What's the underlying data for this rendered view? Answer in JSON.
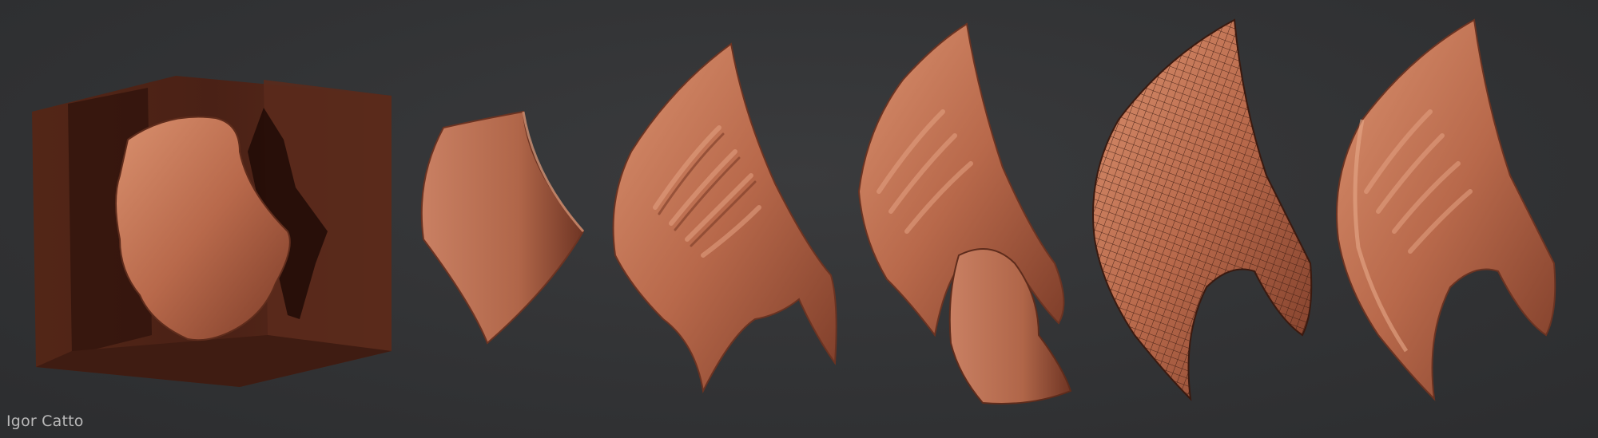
{
  "credit": {
    "author": "Igor Catto"
  },
  "stages": [
    {
      "name": "blockout-in-box"
    },
    {
      "name": "basic-shape"
    },
    {
      "name": "pauldron-sculpt"
    },
    {
      "name": "pauldron-with-detail"
    },
    {
      "name": "wireframe-topology"
    },
    {
      "name": "final-sculpt"
    }
  ],
  "colors": {
    "background": "#333436",
    "clay": "#b56a4c",
    "clay_light": "#d58b6a",
    "clay_dark": "#6e3524",
    "box": "#4a2217",
    "credit_text": "#b9b9b9"
  }
}
